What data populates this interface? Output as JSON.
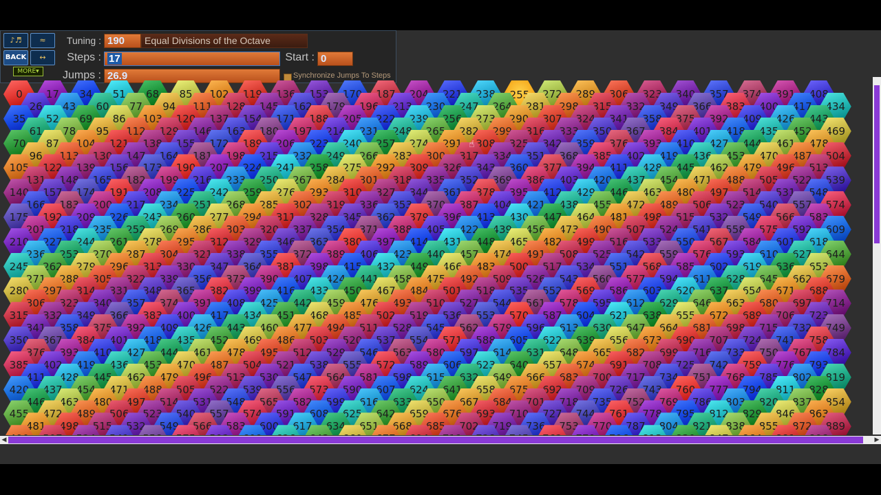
{
  "toolbar": {
    "btn1_label": "♪♬",
    "btn2_label": "≈",
    "back_label": "BACK",
    "btn4_label": "↔",
    "more_label": "MORE▾"
  },
  "tuning": {
    "label": "Tuning :",
    "value": "190",
    "description": "Equal Divisions of the Octave"
  },
  "steps": {
    "label": "Steps :",
    "value": "17"
  },
  "start": {
    "label": "Start :",
    "value": "0"
  },
  "jumps": {
    "label": "Jumps :",
    "value": "26.9"
  },
  "sync": {
    "label": "Synchronize Jumps To Steps"
  },
  "grid": {
    "steps_per_col": 17,
    "steps_per_row": 35,
    "row0_base": 0,
    "row1_base": 26,
    "cols": 25,
    "rows": 15,
    "highlight": 255,
    "edo": 190
  },
  "colors": {
    "accent_scrollbar": "#8a3ad6",
    "highlight_glow": "#ffb000"
  }
}
